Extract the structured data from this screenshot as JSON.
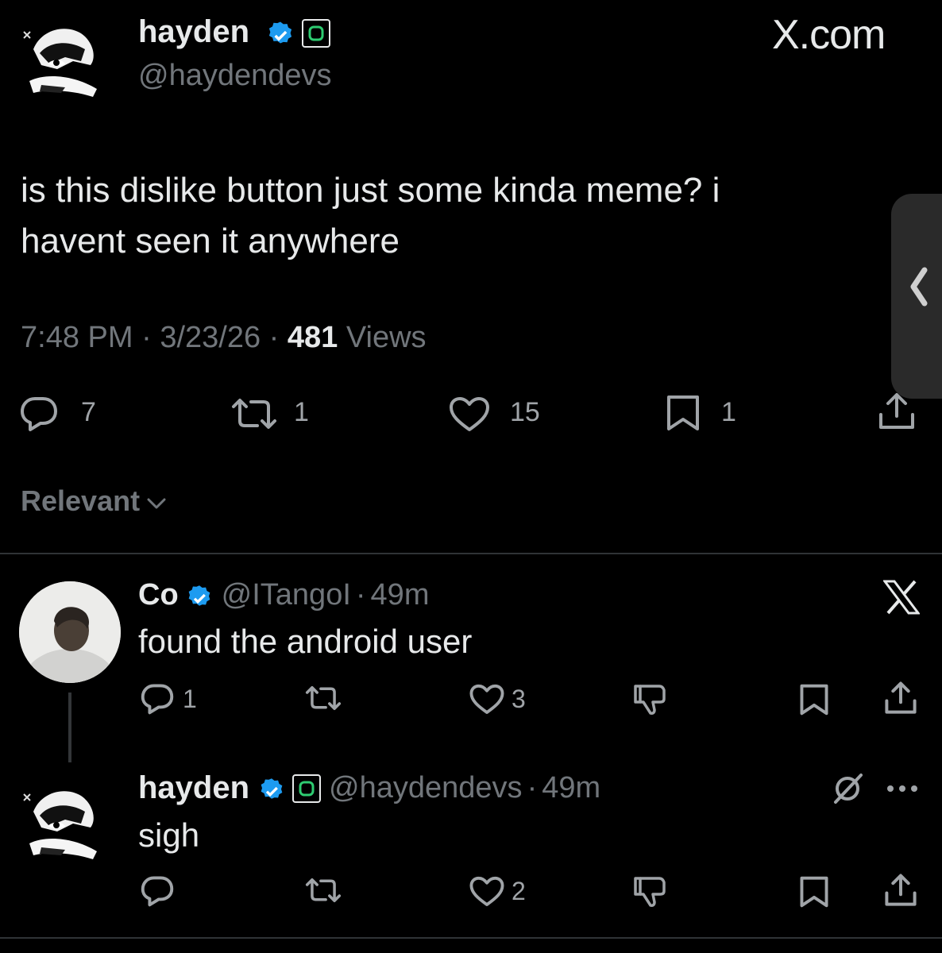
{
  "main_tweet": {
    "display_name": "hayden",
    "handle": "@haydendevs",
    "site": "X.com",
    "text_line1": "is this dislike button just some kinda meme? i",
    "text_line2": "havent seen it anywhere",
    "time": "7:48 PM",
    "date": "3/23/26",
    "views_count": "481",
    "views_label": "Views",
    "sep": "·",
    "reply_count": "7",
    "repost_count": "1",
    "like_count": "15",
    "bookmark_count": "1"
  },
  "sort": {
    "label": "Relevant"
  },
  "reply1": {
    "display_name": "Co",
    "handle": "@ITangoI",
    "time": "49m",
    "sep": "·",
    "text": "found the android user",
    "reply_count": "1",
    "like_count": "3"
  },
  "reply2": {
    "display_name": "hayden",
    "handle": "@haydendevs",
    "time": "49m",
    "sep": "·",
    "text": "sigh",
    "like_count": "2"
  },
  "colors": {
    "background": "#000000",
    "text": "#e7e9ea",
    "muted": "#71767b",
    "verified": "#1d9bf0",
    "divider": "#2f3336"
  }
}
